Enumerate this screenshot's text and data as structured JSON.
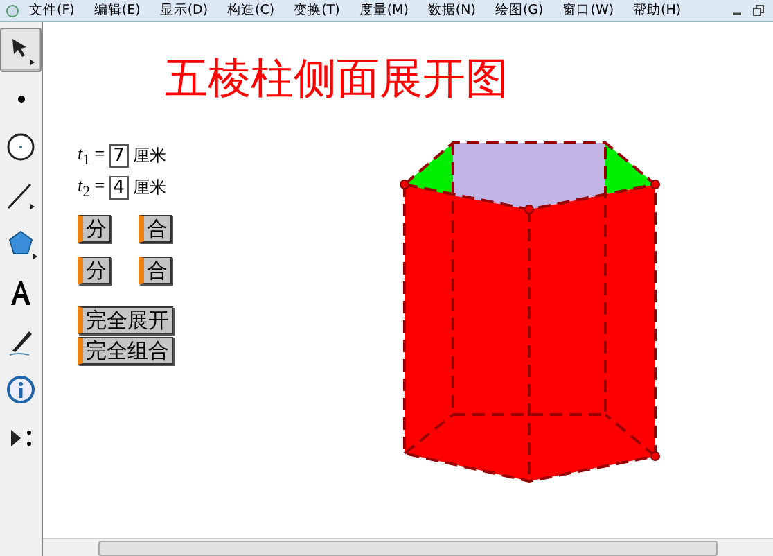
{
  "menu": [
    {
      "label": "文件(F)"
    },
    {
      "label": "编辑(E)"
    },
    {
      "label": "显示(D)"
    },
    {
      "label": "构造(C)"
    },
    {
      "label": "变换(T)"
    },
    {
      "label": "度量(M)"
    },
    {
      "label": "数据(N)"
    },
    {
      "label": "绘图(G)"
    },
    {
      "label": "窗口(W)"
    },
    {
      "label": "帮助(H)"
    }
  ],
  "tools": [
    {
      "kind": "arrow",
      "selected": true
    },
    {
      "kind": "point",
      "selected": false
    },
    {
      "kind": "compass",
      "selected": false
    },
    {
      "kind": "line",
      "selected": false
    },
    {
      "kind": "polygon",
      "selected": false
    },
    {
      "kind": "text",
      "selected": false
    },
    {
      "kind": "marker",
      "selected": false
    },
    {
      "kind": "info",
      "selected": false
    },
    {
      "kind": "custom",
      "selected": false
    }
  ],
  "title": "五棱柱侧面展开图",
  "parameters": [
    {
      "label": "*t*$_{1}$ =",
      "value": "7",
      "unit": "厘米"
    },
    {
      "label": "*t*$_{2}$ =",
      "value": "4",
      "unit": "厘米"
    }
  ],
  "button_rows": [
    [
      "分",
      "合"
    ],
    [
      "分",
      "合"
    ]
  ],
  "action_buttons": [
    "完全展开",
    "完全组合"
  ]
}
